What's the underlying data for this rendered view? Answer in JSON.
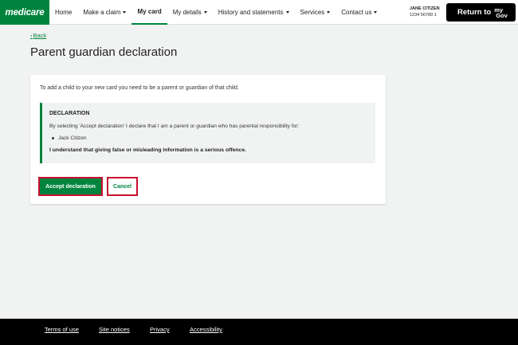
{
  "brand": {
    "logo_text": "medicare",
    "color": "#00843d"
  },
  "nav": {
    "items": [
      {
        "label": "Home"
      },
      {
        "label": "Make a claim"
      },
      {
        "label": "My card"
      },
      {
        "label": "My details"
      },
      {
        "label": "History and statements"
      },
      {
        "label": "Services"
      },
      {
        "label": "Contact us"
      }
    ],
    "active": "My card"
  },
  "user": {
    "name": "JANE CITIZEN",
    "card_number": "1234 56789 1"
  },
  "mygov_button": {
    "label": "Return to",
    "logo_top": "my",
    "logo_bottom": "Gov"
  },
  "page": {
    "back_label": "Back",
    "title": "Parent guardian declaration",
    "intro": "To add a child to your new card you need to be a parent or guardian of that child.",
    "declaration": {
      "heading": "DECLARATION",
      "text": "By selecting 'Accept declaration' I declare that I am a parent or guardian who has parental responsibility for:",
      "children": [
        "Jack Citizen"
      ],
      "warning": "I understand that giving false or misleading information is a serious offence."
    },
    "accept_label": "Accept declaration",
    "cancel_label": "Cancel"
  },
  "footer": {
    "links": [
      {
        "label": "Terms of use"
      },
      {
        "label": "Site notices"
      },
      {
        "label": "Privacy"
      },
      {
        "label": "Accessibility"
      }
    ]
  }
}
